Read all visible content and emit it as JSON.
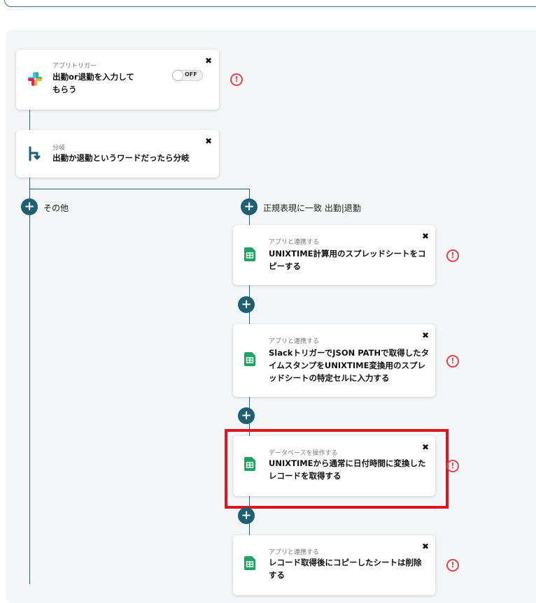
{
  "trigger": {
    "category": "アプリトリガー",
    "title_line1": "出勤or退勤を入力して",
    "title_line2": "もらう",
    "toggle_label": "OFF"
  },
  "branch": {
    "category": "分岐",
    "title": "出勤か退勤というワードだったら分岐"
  },
  "branches": {
    "left_label": "その他",
    "right_label": "正規表現に一致 出勤|退勤"
  },
  "steps": [
    {
      "category": "アプリと連携する",
      "title_line1": "UNIXTIME計算用のスプレッドシートをコ",
      "title_line2": "ピーする"
    },
    {
      "category": "アプリと連携する",
      "title_line1": "SlackトリガーでJSON PATHで取得したタ",
      "title_line2": "イムスタンプをUNIXTIME変換用のスプレ",
      "title_line3": "ッドシートの特定セルに入力する"
    },
    {
      "category": "データベースを操作する",
      "title_line1": "UNIXTIMEから通常に日付時間に変換した",
      "title_line2": "レコードを取得する"
    },
    {
      "category": "アプリと連携する",
      "title_line1": "レコード取得後にコピーしたシートは削除",
      "title_line2": "する"
    }
  ],
  "icons": {
    "close": "✖",
    "plus": "+",
    "warning": "!"
  },
  "colors": {
    "accent": "#1e5f73",
    "warning": "#e0454f",
    "highlight": "#e0141e",
    "sheets_green": "#1fa463"
  }
}
